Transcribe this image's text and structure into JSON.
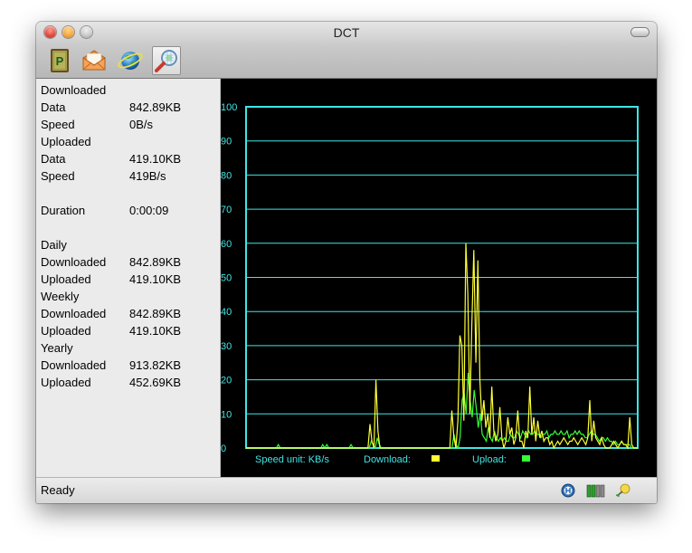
{
  "window": {
    "title": "DCT"
  },
  "toolbar": {
    "buttons": [
      {
        "name": "p-icon",
        "glyph": "P"
      },
      {
        "name": "mail-icon"
      },
      {
        "name": "globe-icon"
      },
      {
        "name": "magnifier-icon"
      }
    ]
  },
  "stats": {
    "downloaded_heading": "Downloaded",
    "downloaded_data_label": "Data",
    "downloaded_data_value": "842.89KB",
    "downloaded_speed_label": "Speed",
    "downloaded_speed_value": "0B/s",
    "uploaded_heading": "Uploaded",
    "uploaded_data_label": "Data",
    "uploaded_data_value": "419.10KB",
    "uploaded_speed_label": "Speed",
    "uploaded_speed_value": "419B/s",
    "duration_label": "Duration",
    "duration_value": "0:00:09",
    "daily_heading": "Daily",
    "daily_downloaded_label": "Downloaded",
    "daily_downloaded_value": "842.89KB",
    "daily_uploaded_label": "Uploaded",
    "daily_uploaded_value": "419.10KB",
    "weekly_heading": "Weekly",
    "weekly_downloaded_label": "Downloaded",
    "weekly_downloaded_value": "842.89KB",
    "weekly_uploaded_label": "Uploaded",
    "weekly_uploaded_value": "419.10KB",
    "yearly_heading": "Yearly",
    "yearly_downloaded_label": "Downloaded",
    "yearly_downloaded_value": "913.82KB",
    "yearly_uploaded_label": "Uploaded",
    "yearly_uploaded_value": "452.69KB"
  },
  "graph": {
    "speed_unit_label": "Speed unit: KB/s",
    "download_label": "Download:",
    "upload_label": "Upload:",
    "download_color": "#ffff33",
    "upload_color": "#33ff33",
    "grid_color": "#3fe6e6"
  },
  "chart_data": {
    "type": "line",
    "ylim": [
      0,
      100
    ],
    "yticks": [
      "0",
      "10",
      "20",
      "30",
      "40",
      "50",
      "60",
      "70",
      "80",
      "90",
      "100"
    ],
    "grid": true,
    "ylabel": "",
    "series": [
      {
        "name": "Download",
        "values": [
          0,
          0,
          0,
          0,
          0,
          0,
          0,
          0,
          0,
          0,
          0,
          0,
          0,
          0,
          0,
          0,
          0,
          0,
          0,
          0,
          0,
          0,
          0,
          0,
          0,
          0,
          0,
          0,
          0,
          0,
          0,
          0,
          0,
          0,
          0,
          0,
          0,
          0,
          0,
          0,
          0,
          0,
          0,
          0,
          0,
          0,
          0,
          0,
          0,
          0,
          0,
          0,
          0,
          0,
          0,
          0,
          0,
          0,
          0,
          0,
          0,
          0,
          7,
          2,
          0,
          20,
          5,
          0,
          0,
          0,
          0,
          0,
          0,
          0,
          0,
          0,
          0,
          0,
          0,
          0,
          0,
          0,
          0,
          0,
          0,
          0,
          0,
          0,
          0,
          0,
          0,
          0,
          0,
          0,
          0,
          0,
          0,
          0,
          0,
          0,
          0,
          0,
          0,
          11,
          3,
          0,
          8,
          33,
          30,
          8,
          60,
          45,
          10,
          36,
          58,
          25,
          55,
          20,
          8,
          14,
          6,
          10,
          3,
          18,
          5,
          2,
          4,
          12,
          3,
          0,
          2,
          9,
          4,
          6,
          1,
          3,
          11,
          2,
          2,
          0,
          5,
          3,
          18,
          4,
          9,
          2,
          8,
          3,
          5,
          2,
          3,
          3,
          1,
          2,
          0,
          1,
          2,
          1,
          2,
          3,
          2,
          1,
          2,
          2,
          3,
          2,
          1,
          2,
          3,
          2,
          1,
          3,
          14,
          2,
          8,
          3,
          2,
          1,
          3,
          1,
          0,
          0,
          0,
          1,
          2,
          1,
          0,
          1,
          2,
          1,
          1,
          0,
          9,
          1,
          0,
          0,
          0
        ]
      },
      {
        "name": "Upload",
        "values": [
          0,
          0,
          0,
          0,
          0,
          0,
          0,
          0,
          0,
          0,
          0,
          0,
          0,
          0,
          0,
          0,
          1,
          0,
          0,
          0,
          0,
          0,
          0,
          0,
          0,
          0,
          0,
          0,
          0,
          0,
          0,
          0,
          0,
          0,
          0,
          0,
          0,
          0,
          1,
          0,
          1,
          0,
          0,
          0,
          0,
          0,
          0,
          0,
          0,
          0,
          0,
          0,
          1,
          0,
          0,
          0,
          0,
          0,
          0,
          0,
          0,
          0,
          2,
          1,
          0,
          3,
          1,
          0,
          0,
          0,
          0,
          0,
          0,
          0,
          0,
          0,
          0,
          0,
          0,
          0,
          0,
          0,
          0,
          0,
          0,
          0,
          0,
          0,
          0,
          0,
          0,
          0,
          0,
          0,
          0,
          0,
          0,
          0,
          0,
          0,
          0,
          0,
          0,
          4,
          1,
          0,
          3,
          14,
          16,
          10,
          22,
          14,
          9,
          17,
          12,
          6,
          10,
          4,
          3,
          2,
          6,
          3,
          2,
          5,
          3,
          2,
          3,
          2,
          3,
          2,
          2,
          4,
          3,
          3,
          5,
          4,
          3,
          5,
          4,
          3,
          5,
          4,
          4,
          5,
          4,
          4,
          3,
          4,
          4,
          5,
          3,
          4,
          4,
          5,
          4,
          4,
          5,
          4,
          4,
          5,
          3,
          4,
          4,
          5,
          4,
          5,
          4,
          4,
          3,
          3,
          4,
          5,
          4,
          4,
          3,
          2,
          3,
          3,
          2,
          3,
          2,
          2,
          1,
          2,
          1,
          1,
          2,
          1,
          1,
          1,
          1,
          0,
          0,
          0,
          0
        ]
      }
    ]
  },
  "statusbar": {
    "text": "Ready"
  }
}
